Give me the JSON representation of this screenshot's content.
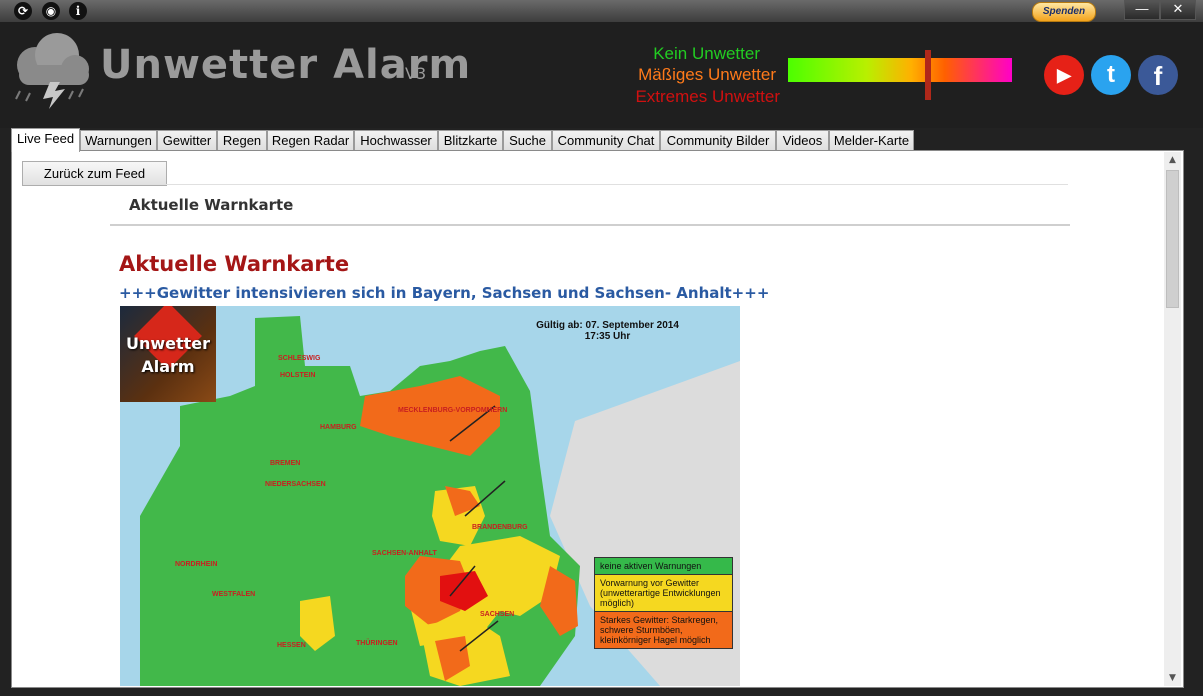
{
  "titlebar": {
    "icons": [
      "refresh-icon",
      "globe-icon",
      "info-icon"
    ],
    "donate_label": "Spenden",
    "minimize_glyph": "—",
    "close_glyph": "✕"
  },
  "header": {
    "app_title": "Unwetter Alarm",
    "version": "V3",
    "legend": {
      "none": {
        "label": "Kein Unwetter",
        "color": "#22cc22"
      },
      "moderate": {
        "label": "Mäßiges Unwetter",
        "color": "#ff7a1a"
      },
      "extreme": {
        "label": "Extremes Unwetter",
        "color": "#d01010"
      }
    },
    "social": {
      "youtube": "youtube-icon",
      "twitter": "twitter-icon",
      "facebook": "facebook-icon"
    }
  },
  "tabs": [
    {
      "label": "Live Feed",
      "active": true
    },
    {
      "label": "Warnungen"
    },
    {
      "label": "Gewitter"
    },
    {
      "label": "Regen"
    },
    {
      "label": "Regen Radar"
    },
    {
      "label": "Hochwasser"
    },
    {
      "label": "Blitzkarte"
    },
    {
      "label": "Suche"
    },
    {
      "label": "Community Chat"
    },
    {
      "label": "Community Bilder"
    },
    {
      "label": "Videos"
    },
    {
      "label": "Melder-Karte"
    }
  ],
  "content": {
    "back_button": "Zurück zum Feed",
    "page_subtitle": "Aktuelle Warnkarte",
    "article_title": "Aktuelle Warnkarte",
    "article_subtitle": "+++Gewitter intensivieren sich in Bayern, Sachsen und Sachsen- Anhalt+++",
    "map": {
      "badge_line1": "Unwetter",
      "badge_line2": "Alarm",
      "valid_line1": "Gültig ab: 07. September 2014",
      "valid_line2": "17:35 Uhr",
      "regions": [
        "SCHLESWIG",
        "HOLSTEIN",
        "MECKLENBURG-VORPOMMERN",
        "NIEDERSACHSEN",
        "BRANDENBURG",
        "SACHSEN-ANHALT",
        "NORDRHEIN",
        "WESTFALEN",
        "HESSEN",
        "THÜRINGEN",
        "SACHSEN",
        "BREMEN",
        "HAMBURG"
      ],
      "legend": [
        {
          "label": "keine aktiven Warnungen",
          "color": "#35b94a"
        },
        {
          "label": "Vorwarnung vor Gewitter (unwetterartige Entwicklungen möglich)",
          "color": "#f5d820"
        },
        {
          "label": "Starkes Gewitter: Starkregen, schwere Sturmböen, kleinkörniger Hagel möglich",
          "color": "#f26a1a"
        }
      ]
    }
  }
}
